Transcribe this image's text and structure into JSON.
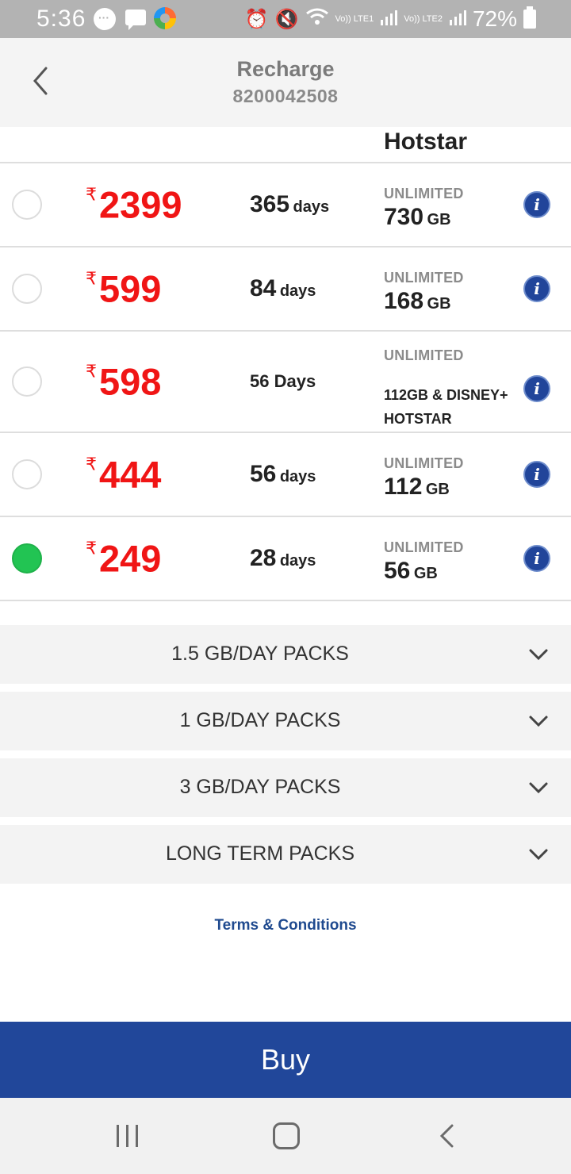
{
  "status_bar": {
    "time": "5:36",
    "lte1": "Vo)) LTE1",
    "lte2": "Vo)) LTE2",
    "battery": "72%",
    "icons": [
      "chat-bubble-icon",
      "message-icon",
      "app-icon",
      "alarm-icon",
      "mute-icon",
      "wifi-icon",
      "signal-icon",
      "battery-icon"
    ]
  },
  "header": {
    "title": "Recharge",
    "number": "8200042508"
  },
  "column_header": "Hotstar",
  "plans": [
    {
      "rupee": "₹",
      "price": "2399",
      "validity_num": "365",
      "validity_unit": "days",
      "calls": "UNLIMITED",
      "data_num": "730",
      "data_unit": "GB",
      "selected": false
    },
    {
      "rupee": "₹",
      "price": "599",
      "validity_num": "84",
      "validity_unit": "days",
      "calls": "UNLIMITED",
      "data_num": "168",
      "data_unit": "GB",
      "selected": false
    },
    {
      "rupee": "₹",
      "price": "598",
      "validity": "56 Days",
      "calls": "UNLIMITED",
      "data": "112GB & DISNEY+ HOTSTAR",
      "selected": false
    },
    {
      "rupee": "₹",
      "price": "444",
      "validity_num": "56",
      "validity_unit": "days",
      "calls": "UNLIMITED",
      "data_num": "112",
      "data_unit": "GB",
      "selected": false
    },
    {
      "rupee": "₹",
      "price": "249",
      "validity_num": "28",
      "validity_unit": "days",
      "calls": "UNLIMITED",
      "data_num": "56",
      "data_unit": "GB",
      "selected": true
    }
  ],
  "info_glyph": "i",
  "accordions": [
    {
      "label": "1.5 GB/DAY PACKS"
    },
    {
      "label": "1 GB/DAY PACKS"
    },
    {
      "label": "3 GB/DAY PACKS"
    },
    {
      "label": "LONG TERM PACKS"
    }
  ],
  "terms": "Terms & Conditions",
  "buy_label": "Buy",
  "colors": {
    "price": "#f01515",
    "selected": "#22c453",
    "buy_button": "#21479a",
    "info_icon": "#21459a",
    "link": "#1f4a8f"
  }
}
